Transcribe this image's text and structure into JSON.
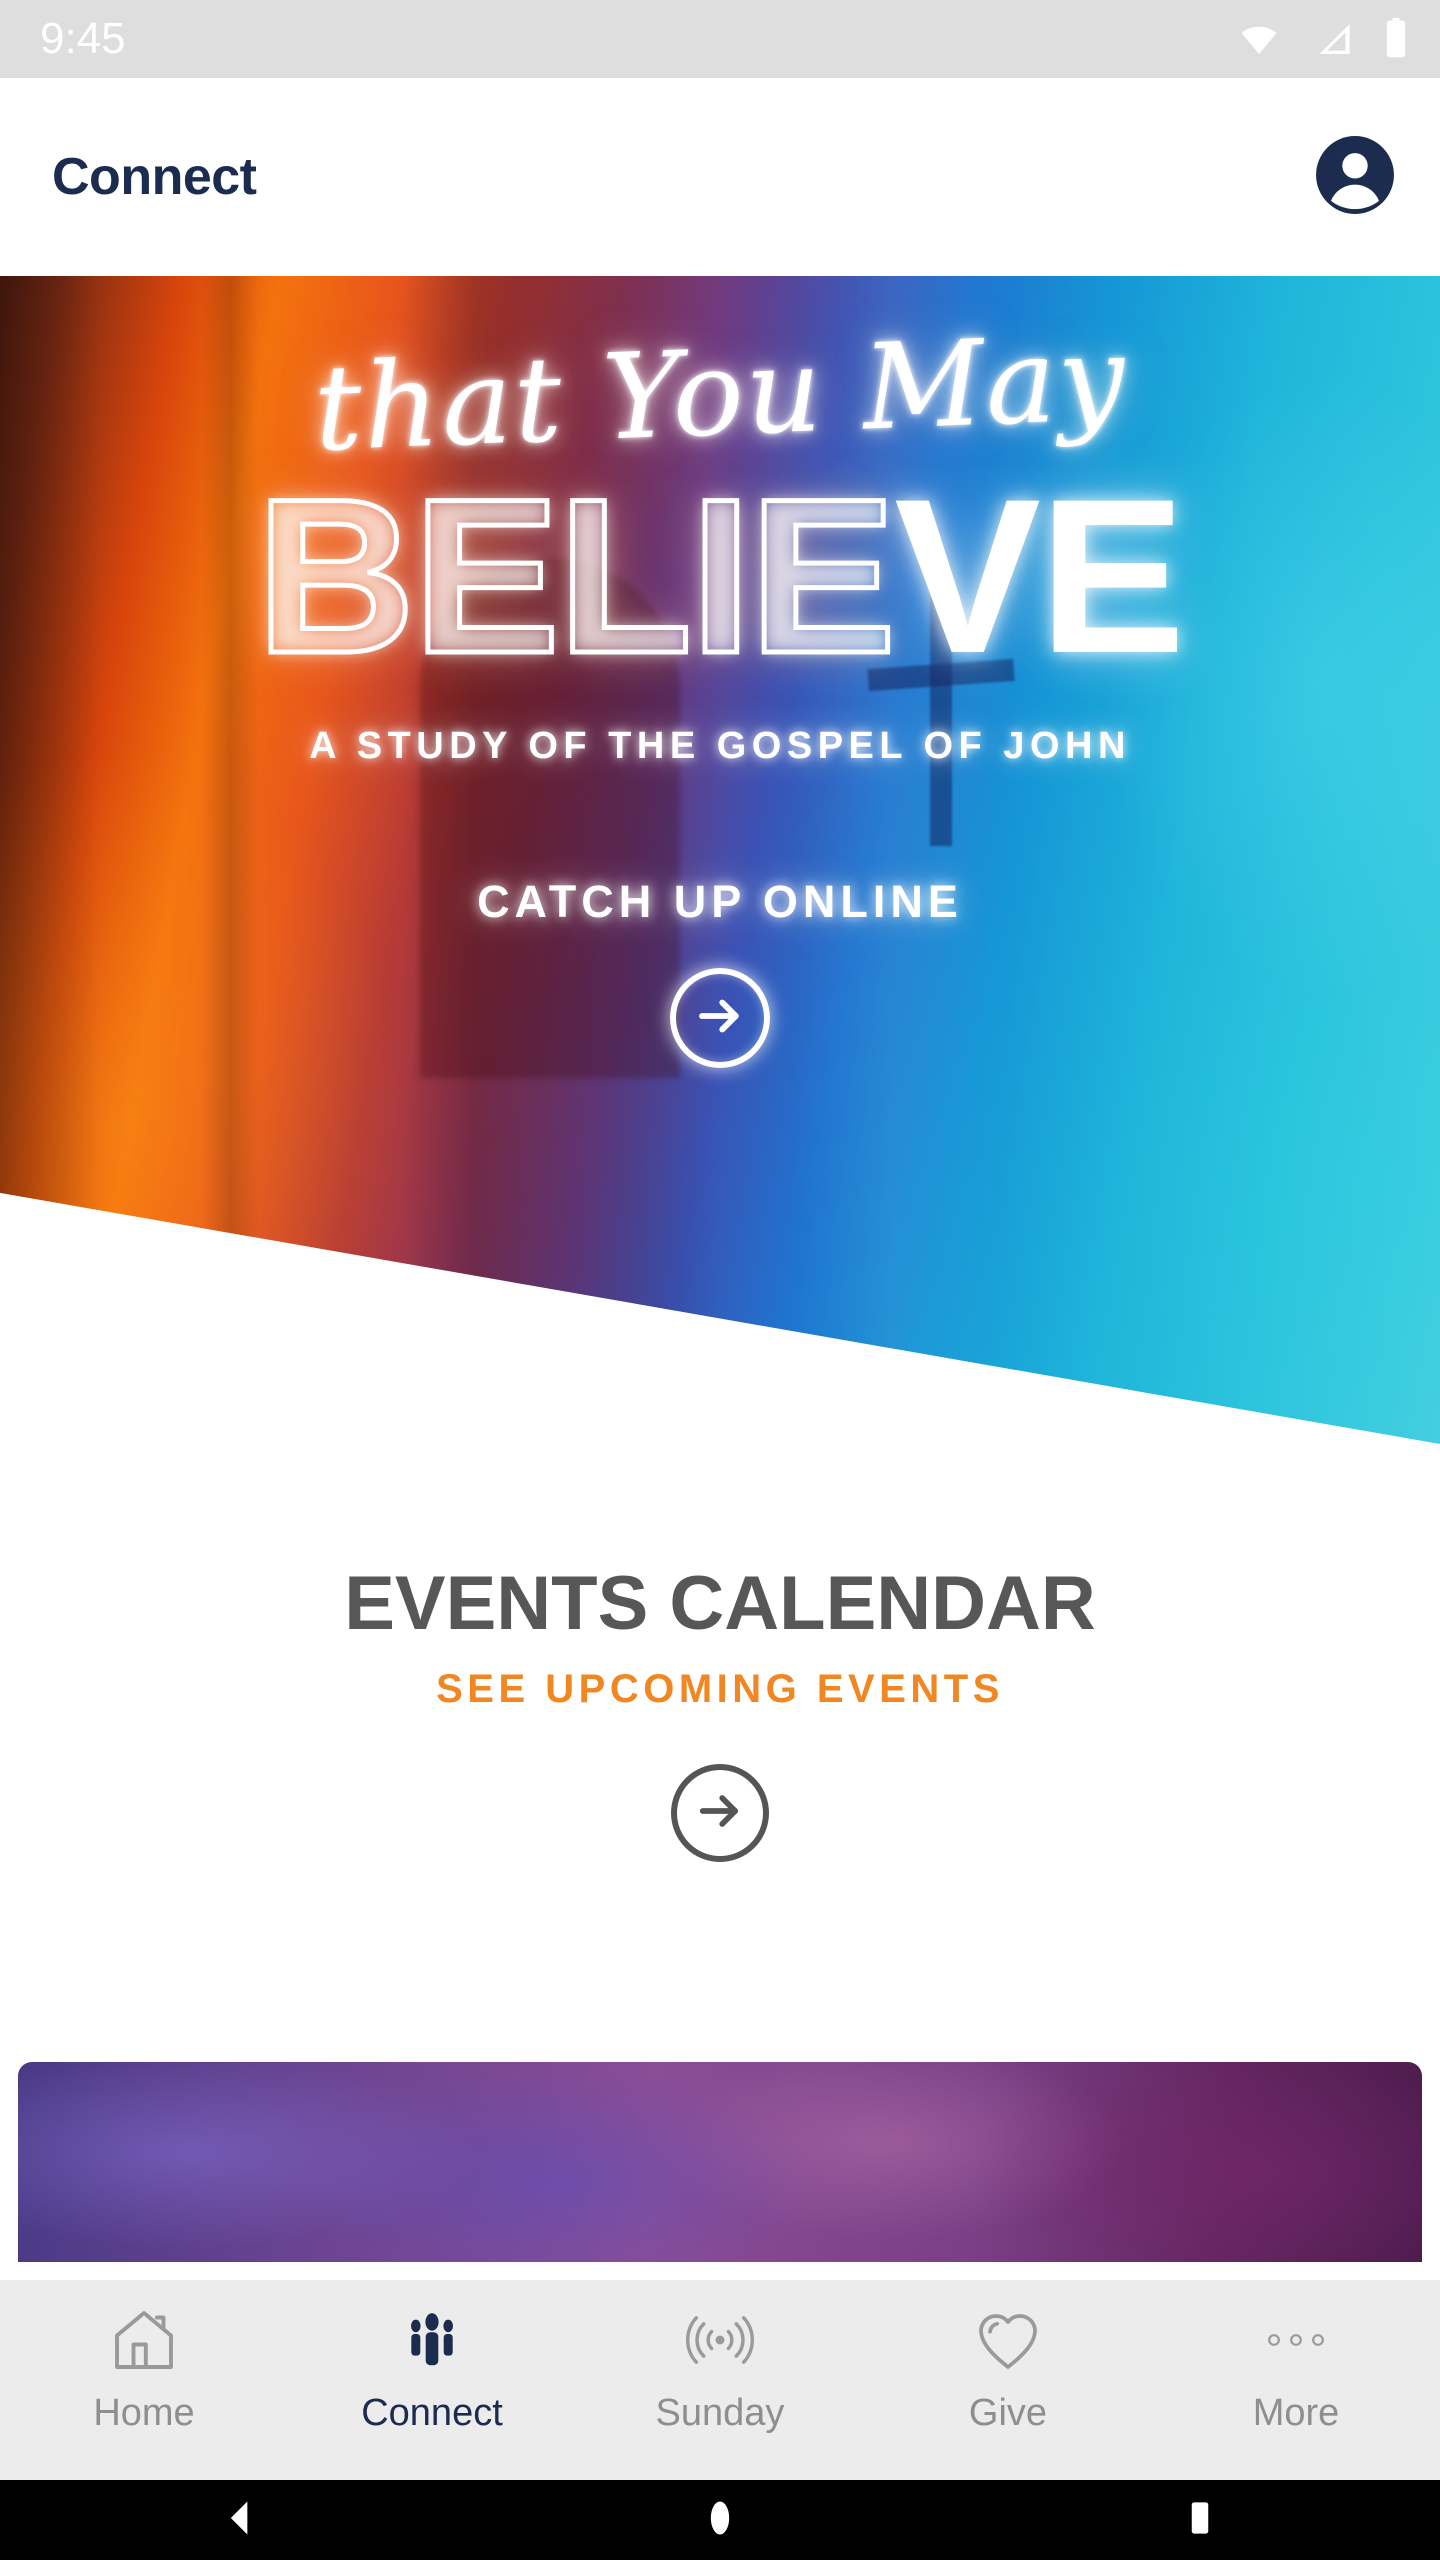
{
  "status_bar": {
    "time": "9:45",
    "icons": [
      "wifi-icon",
      "cellular-signal-icon",
      "battery-icon"
    ]
  },
  "header": {
    "title": "Connect",
    "avatar_icon": "account-avatar-icon",
    "title_color": "#1c2c4f"
  },
  "hero": {
    "script_line": "that You May",
    "headline_outline": "BELIE",
    "headline_solid": "VE",
    "headline_full": "BELIEVE",
    "subtitle": "A STUDY OF THE GOSPEL OF JOHN",
    "cta_text": "CATCH UP ONLINE",
    "cta_icon": "arrow-right-circle-icon",
    "gradient_start": "#5a1f12",
    "gradient_orange": "#f4720d",
    "gradient_blue": "#1f74cf",
    "gradient_end": "#45cfe0"
  },
  "events": {
    "title": "EVENTS CALENDAR",
    "subtitle": "SEE UPCOMING EVENTS",
    "arrow_icon": "arrow-right-circle-icon",
    "title_color": "#575757",
    "subtitle_color": "#f08722"
  },
  "photo_card": {
    "overlay_color": "#6b4492"
  },
  "tabbar": {
    "active_color": "#1c2c4f",
    "inactive_color": "#8e8e8e",
    "items": [
      {
        "label": "Home",
        "icon": "home-icon",
        "active": false
      },
      {
        "label": "Connect",
        "icon": "people-icon",
        "active": true
      },
      {
        "label": "Sunday",
        "icon": "broadcast-icon",
        "active": false
      },
      {
        "label": "Give",
        "icon": "heart-icon",
        "active": false
      },
      {
        "label": "More",
        "icon": "ellipsis-icon",
        "active": false
      }
    ]
  },
  "android_nav": {
    "back": "back-triangle-icon",
    "home": "home-circle-icon",
    "recents": "recents-square-icon"
  }
}
